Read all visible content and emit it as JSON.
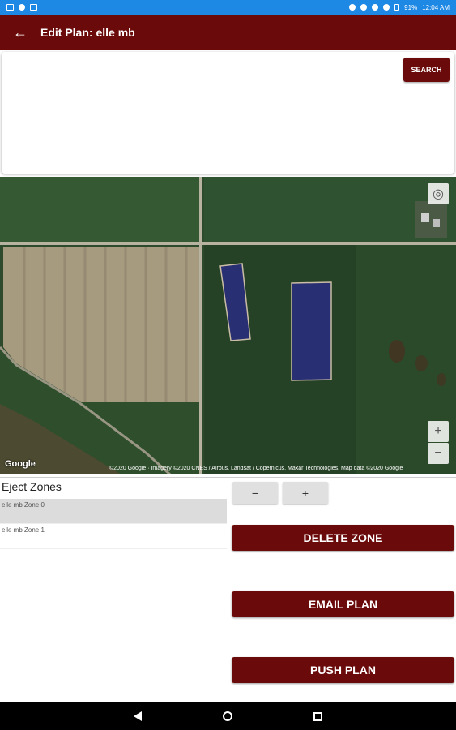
{
  "status_bar": {
    "battery": "91%",
    "time": "12:04 AM"
  },
  "app_bar": {
    "back_icon": "arrow-left-icon",
    "title": "Edit Plan: elle mb"
  },
  "search": {
    "value": "",
    "placeholder": "",
    "button_label": "SEARCH"
  },
  "map": {
    "logo": "Google",
    "attribution": "©2020 Google · Imagery ©2020 CNES / Airbus, Landsat / Copernicus, Maxar Technologies, Map data ©2020 Google",
    "locate_icon": "my-location-icon",
    "zoom_in": "+",
    "zoom_out": "−",
    "zone_color": "#2a2e7a"
  },
  "zones": {
    "heading": "Eject Zones",
    "items": [
      {
        "label": "elle mb Zone 0",
        "selected": true
      },
      {
        "label": "elle mb Zone 1",
        "selected": false
      }
    ]
  },
  "stepper": {
    "minus": "−",
    "plus": "+"
  },
  "actions": {
    "delete": "DELETE ZONE",
    "email": "EMAIL PLAN",
    "push": "PUSH PLAN"
  },
  "colors": {
    "primary": "#6b0a0a",
    "status_bar": "#1e88e5"
  }
}
